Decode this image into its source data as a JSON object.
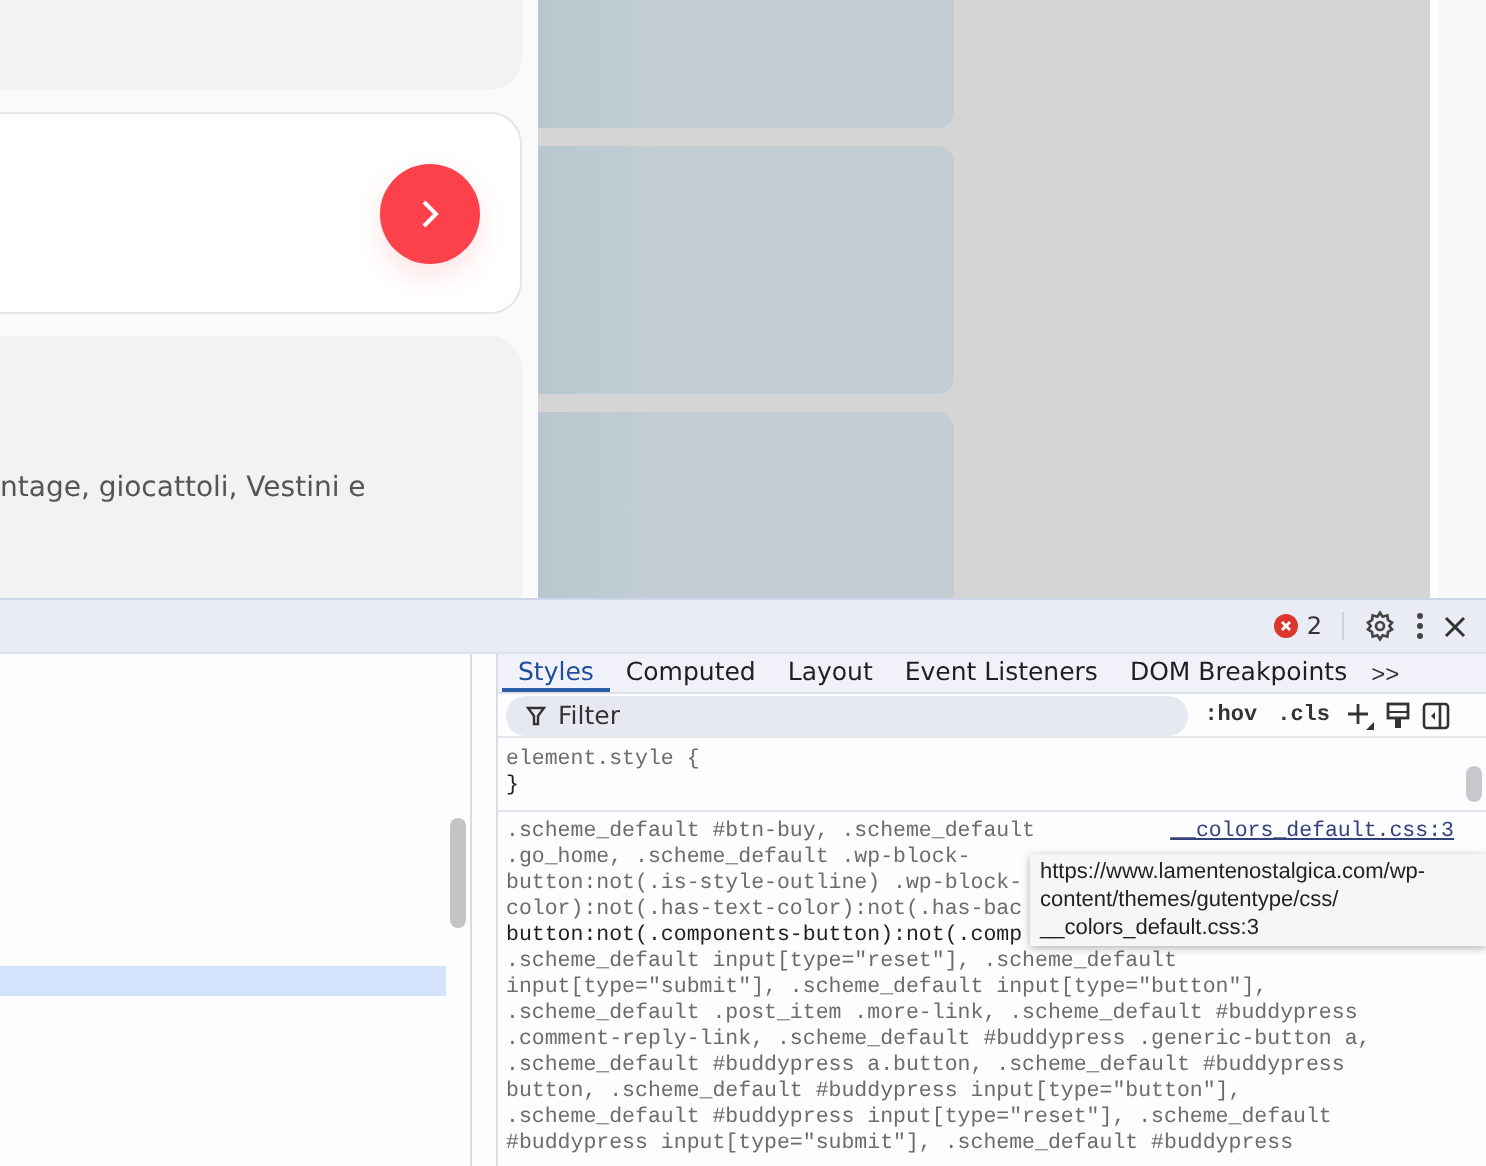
{
  "page": {
    "card_text": "ntage, giocattoli, Vestini e"
  },
  "devtools": {
    "error_count": "2",
    "tabs": [
      {
        "label": "Styles",
        "selected": true
      },
      {
        "label": "Computed",
        "selected": false
      },
      {
        "label": "Layout",
        "selected": false
      },
      {
        "label": "Event Listeners",
        "selected": false
      },
      {
        "label": "DOM Breakpoints",
        "selected": false
      }
    ],
    "more_tabs": ">>",
    "filter": {
      "placeholder": "Filter"
    },
    "toggles": [
      ":hov",
      ".cls"
    ],
    "element_style": {
      "selector": "element.style {",
      "close": "}"
    },
    "rule": {
      "source": "__colors_default.css:3",
      "lines": [
        {
          "text": ".scheme_default #btn-buy, .scheme_default",
          "matched": false
        },
        {
          "text": ".go_home, .scheme_default .wp-block-",
          "matched": false
        },
        {
          "text": "button:not(.is-style-outline) .wp-block-",
          "matched": false
        },
        {
          "text": "color):not(.has-text-color):not(.has-bac",
          "matched": false
        },
        {
          "text": "button:not(.components-button):not(.comp",
          "matched": true
        },
        {
          "text": ".scheme_default input[type=\"reset\"], .scheme_default",
          "matched": false
        },
        {
          "text": "input[type=\"submit\"], .scheme_default input[type=\"button\"],",
          "matched": false
        },
        {
          "text": ".scheme_default .post_item .more-link, .scheme_default #buddypress",
          "matched": false
        },
        {
          "text": ".comment-reply-link, .scheme_default #buddypress .generic-button a,",
          "matched": false
        },
        {
          "text": ".scheme_default #buddypress a.button, .scheme_default #buddypress",
          "matched": false
        },
        {
          "text": "button, .scheme_default #buddypress input[type=\"button\"],",
          "matched": false
        },
        {
          "text": ".scheme_default #buddypress input[type=\"reset\"], .scheme_default",
          "matched": false
        },
        {
          "text": "#buddypress input[type=\"submit\"], .scheme_default #buddypress",
          "matched": false
        }
      ]
    },
    "tooltip": [
      "https://www.lamentenostalgica.com/wp-",
      "content/themes/gutentype/css/",
      "__colors_default.css:3"
    ]
  }
}
